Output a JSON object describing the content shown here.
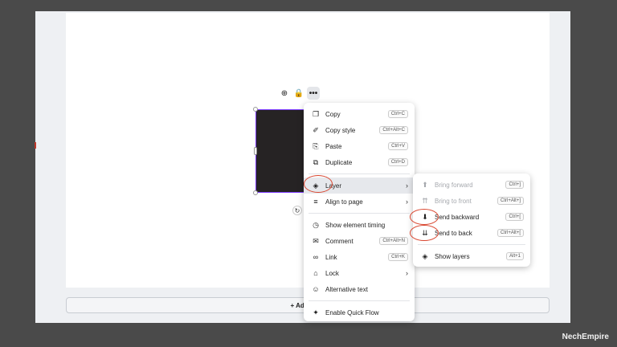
{
  "canvas": {
    "add_page_label": "+ Add page"
  },
  "toolbar": {
    "items": [
      {
        "icon": "comment-plus-icon",
        "glyph": "⊕"
      },
      {
        "icon": "lock-icon",
        "glyph": "🔒"
      },
      {
        "icon": "more-icon",
        "glyph": "•••"
      }
    ]
  },
  "rotate_glyph": "↻",
  "context_menu": {
    "items": [
      {
        "icon": "copy-icon",
        "glyph": "❐",
        "label": "Copy",
        "shortcut": "Ctrl+C"
      },
      {
        "icon": "paint-roller-icon",
        "glyph": "✐",
        "label": "Copy style",
        "shortcut": "Ctrl+Alt+C"
      },
      {
        "icon": "clipboard-icon",
        "glyph": "⎘",
        "label": "Paste",
        "shortcut": "Ctrl+V"
      },
      {
        "icon": "duplicate-icon",
        "glyph": "⧉",
        "label": "Duplicate",
        "shortcut": "Ctrl+D"
      },
      {
        "icon": "layers-icon",
        "glyph": "◈",
        "label": "Layer",
        "chevron": "›"
      },
      {
        "icon": "align-icon",
        "glyph": "≡",
        "label": "Align to page",
        "chevron": "›"
      },
      {
        "icon": "clock-icon",
        "glyph": "◷",
        "label": "Show element timing"
      },
      {
        "icon": "comment-icon",
        "glyph": "✉",
        "label": "Comment",
        "shortcut": "Ctrl+Alt+N"
      },
      {
        "icon": "link-icon",
        "glyph": "∞",
        "label": "Link",
        "shortcut": "Ctrl+K"
      },
      {
        "icon": "lock-icon",
        "glyph": "⌂",
        "label": "Lock",
        "chevron": "›"
      },
      {
        "icon": "accessibility-icon",
        "glyph": "☺",
        "label": "Alternative text"
      },
      {
        "icon": "quick-flow-icon",
        "glyph": "✦",
        "label": "Enable Quick Flow"
      }
    ]
  },
  "layer_submenu": {
    "items": [
      {
        "icon": "bring-forward-icon",
        "glyph": "⬆",
        "label": "Bring forward",
        "shortcut": "Ctrl+]"
      },
      {
        "icon": "bring-to-front-icon",
        "glyph": "⇈",
        "label": "Bring to front",
        "shortcut": "Ctrl+Alt+]"
      },
      {
        "icon": "send-backward-icon",
        "glyph": "⬇",
        "label": "Send backward",
        "shortcut": "Ctrl+["
      },
      {
        "icon": "send-to-back-icon",
        "glyph": "⇊",
        "label": "Send to back",
        "shortcut": "Ctrl+Alt+["
      },
      {
        "icon": "layers-icon",
        "glyph": "◈",
        "label": "Show layers",
        "shortcut": "Alt+1"
      }
    ]
  },
  "watermark": "NechEmpire",
  "colors": {
    "selection": "#7d3cff",
    "annotation": "#d9462f"
  }
}
